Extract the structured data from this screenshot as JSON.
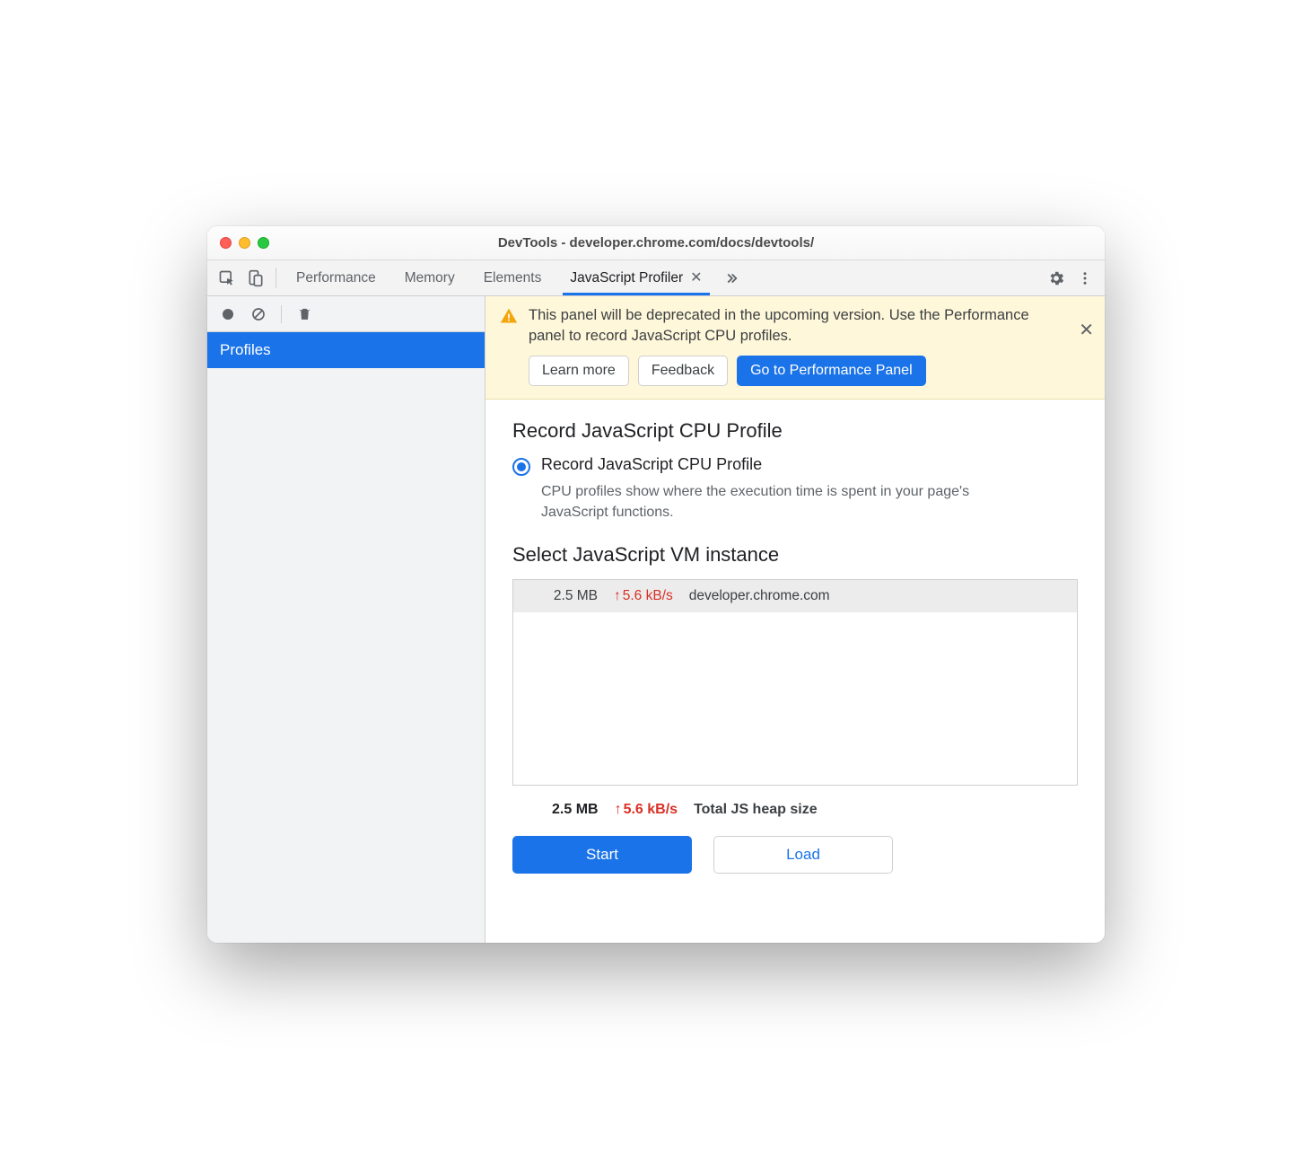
{
  "window": {
    "title": "DevTools - developer.chrome.com/docs/devtools/"
  },
  "tabs": {
    "items": [
      "Performance",
      "Memory",
      "Elements",
      "JavaScript Profiler"
    ],
    "activeIndex": 3
  },
  "sidebar": {
    "profiles_label": "Profiles"
  },
  "banner": {
    "text": "This panel will be deprecated in the upcoming version. Use the Performance panel to record JavaScript CPU profiles.",
    "learn_more": "Learn more",
    "feedback": "Feedback",
    "goto": "Go to Performance Panel"
  },
  "profile": {
    "heading": "Record JavaScript CPU Profile",
    "option_label": "Record JavaScript CPU Profile",
    "option_desc": "CPU profiles show where the execution time is spent in your page's JavaScript functions."
  },
  "vm": {
    "heading": "Select JavaScript VM instance",
    "row": {
      "size": "2.5 MB",
      "rate": "5.6 kB/s",
      "host": "developer.chrome.com"
    },
    "total": {
      "size": "2.5 MB",
      "rate": "5.6 kB/s",
      "label": "Total JS heap size"
    }
  },
  "actions": {
    "start": "Start",
    "load": "Load"
  }
}
